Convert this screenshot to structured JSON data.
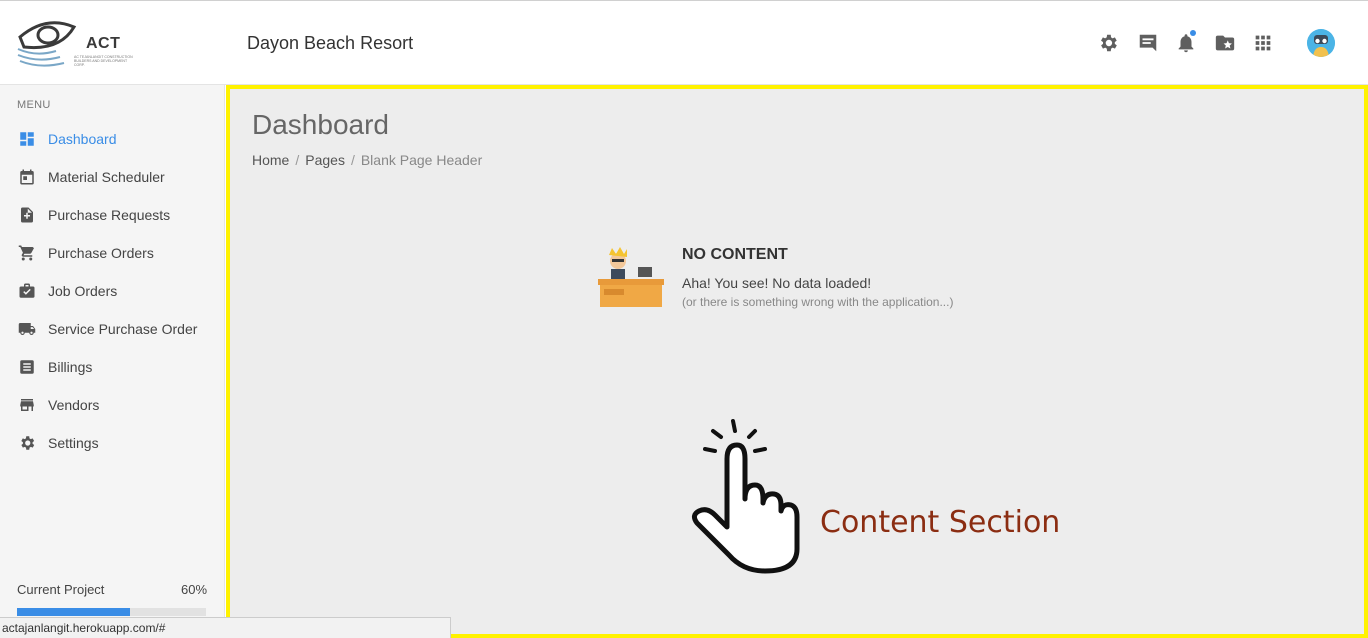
{
  "header": {
    "logo_text": "ACT",
    "logo_subtext": "AC TEJANLANGIT CONSTRUCTION BUILDERS AND DEVELOPMENT CORP.",
    "app_title": "Dayon Beach Resort",
    "icons": [
      "gear-icon",
      "chat-icon",
      "bell-icon",
      "folder-star-icon",
      "apps-grid-icon",
      "avatar"
    ]
  },
  "sidebar": {
    "menu_heading": "MENU",
    "items": [
      {
        "label": "Dashboard",
        "icon": "dashboard-icon",
        "active": true
      },
      {
        "label": "Material Scheduler",
        "icon": "calendar-icon",
        "active": false
      },
      {
        "label": "Purchase Requests",
        "icon": "file-add-icon",
        "active": false
      },
      {
        "label": "Purchase Orders",
        "icon": "cart-icon",
        "active": false
      },
      {
        "label": "Job Orders",
        "icon": "briefcase-check-icon",
        "active": false
      },
      {
        "label": "Service Purchase Order",
        "icon": "truck-icon",
        "active": false
      },
      {
        "label": "Billings",
        "icon": "list-doc-icon",
        "active": false
      },
      {
        "label": "Vendors",
        "icon": "store-icon",
        "active": false
      },
      {
        "label": "Settings",
        "icon": "gear-icon",
        "active": false
      }
    ],
    "current_project": {
      "label": "Current Project",
      "percent_text": "60%",
      "progress": 0.6
    }
  },
  "main": {
    "title": "Dashboard",
    "breadcrumb": [
      "Home",
      "Pages",
      "Blank Page Header"
    ],
    "empty_state": {
      "title": "NO CONTENT",
      "message": "Aha! You see! No data loaded!",
      "sub": "(or there is something wrong with the application...)"
    },
    "annotation": "Content Section",
    "highlight_color": "#fff200",
    "annotation_color": "#8b2d12"
  },
  "statusbar": {
    "url": "actajanlangit.herokuapp.com/#"
  },
  "colors": {
    "accent": "#3a8de6"
  }
}
